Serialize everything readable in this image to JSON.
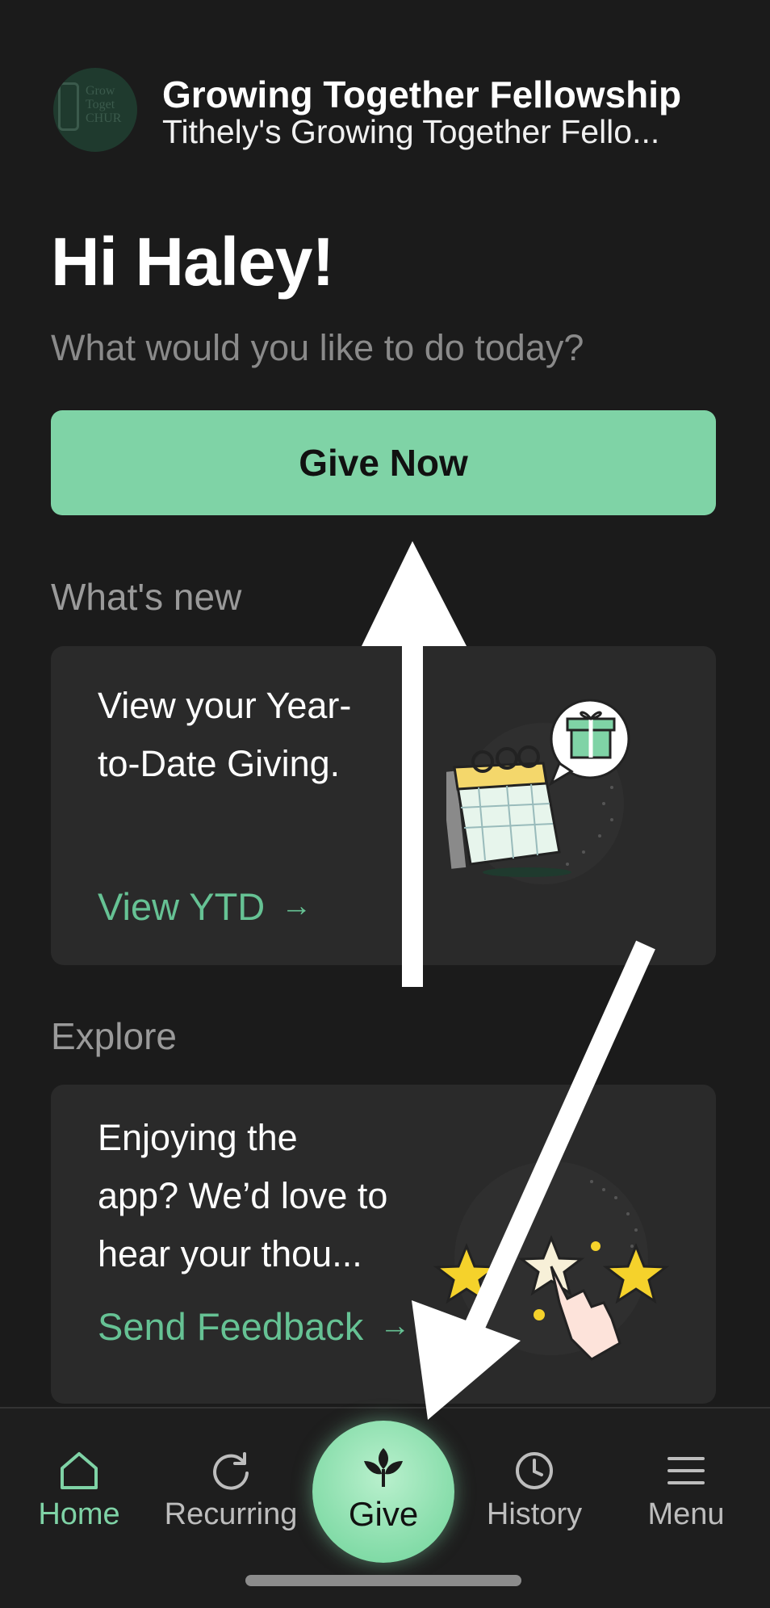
{
  "header": {
    "org_name": "Growing Together Fellowship",
    "org_subtitle": "Tithely's Growing Together Fello...",
    "logo_text": "Grow\nToget\nCHUR"
  },
  "greeting": "Hi Haley!",
  "prompt": "What would you like to do today?",
  "give_now_label": "Give Now",
  "whats_new": {
    "title": "What's new",
    "card_title_line1": "View your Year-",
    "card_title_line2": "to-Date Giving.",
    "link_label": "View YTD",
    "link_arrow": "→"
  },
  "explore": {
    "title": "Explore",
    "card_line1": "Enjoying the",
    "card_line2": "app? We’d love to",
    "card_line3": "hear your thou...",
    "link_label": "Send Feedback",
    "link_arrow": "→"
  },
  "tabbar": {
    "home": "Home",
    "recurring": "Recurring",
    "give": "Give",
    "history": "History",
    "menu": "Menu",
    "active": "home"
  },
  "colors": {
    "accent": "#7fd3a6",
    "link": "#66c294",
    "background": "#1b1b1b",
    "card": "#2a2a2a"
  }
}
